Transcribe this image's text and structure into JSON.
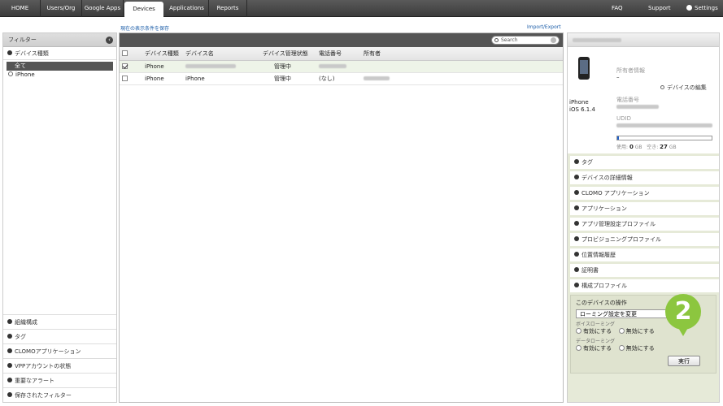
{
  "nav": {
    "tabs": [
      "HOME",
      "Users/Org",
      "Google Apps",
      "Devices",
      "Applications",
      "Reports"
    ],
    "right": [
      "FAQ",
      "Support",
      "Settings"
    ]
  },
  "links": {
    "save_filter": "現在の表示条件を保存",
    "import_export": "Import/Export"
  },
  "left": {
    "header": "フィルター",
    "device_type": "デバイス種類",
    "items": [
      "全て",
      "iPhone"
    ],
    "bottom": [
      "組織構成",
      "タグ",
      "CLOMOアプリケーション",
      "VPPアカウントの状態",
      "重要なアラート",
      "保存されたフィルター"
    ]
  },
  "search": {
    "placeholder": "Search"
  },
  "table": {
    "headers": [
      "デバイス種類",
      "デバイス名",
      "デバイス管理状態",
      "電話番号",
      "所有者"
    ],
    "rows": [
      {
        "type": "iPhone",
        "name": "",
        "status": "管理中",
        "phone": "",
        "owner": ""
      },
      {
        "type": "iPhone",
        "name": "iPhone",
        "status": "管理中",
        "phone": "(なし)",
        "owner": ""
      }
    ]
  },
  "right": {
    "owner_info_label": "所有者情報",
    "owner_info_value": "–",
    "edit_link": "デバイスの編集",
    "device_model": "iPhone",
    "os_version": "iOS 6.1.4",
    "phone_label": "電話番号",
    "udid_label": "UDID",
    "used_label": "使用: ",
    "used_value": "0",
    "used_unit": "GB",
    "free_label": "空き: ",
    "free_value": "27",
    "free_unit": "GB",
    "storage_used_fraction": 0.02,
    "sections": [
      "タグ",
      "デバイスの詳細情報",
      "CLOMO アプリケーション",
      "アプリケーション",
      "アプリ管理設定プロファイル",
      "プロビジョニングプロファイル",
      "位置情報履歴",
      "証明書",
      "構成プロファイル"
    ],
    "ops": {
      "title": "このデバイスの操作",
      "select_value": "ローミング設定を変更",
      "voice_label": "ボイスローミング",
      "data_label": "データローミング",
      "enable": "有効にする",
      "disable": "無効にする",
      "execute": "実行"
    }
  },
  "badge": "2",
  "colors": {
    "accent_green": "#8cc63f",
    "nav_dark": "#444444",
    "storage_fill": "#1f5fc8"
  }
}
